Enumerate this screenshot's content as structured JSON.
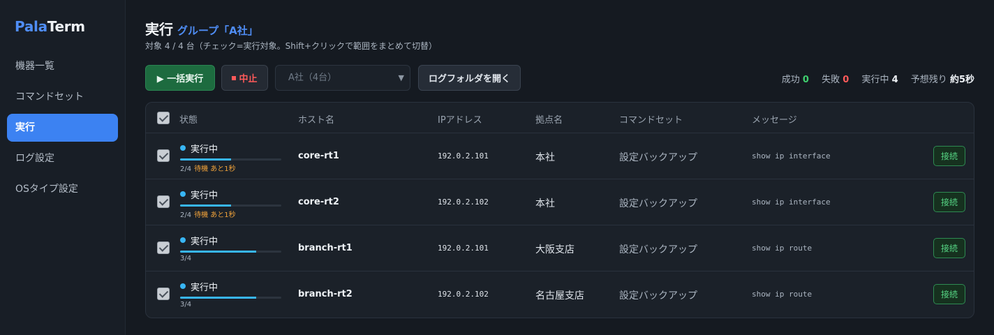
{
  "app": {
    "logo_a": "Pala",
    "logo_b": "Term"
  },
  "sidebar": {
    "items": [
      {
        "label": "機器一覧",
        "active": false
      },
      {
        "label": "コマンドセット",
        "active": false
      },
      {
        "label": "実行",
        "active": true
      },
      {
        "label": "ログ設定",
        "active": false
      },
      {
        "label": "OSタイプ設定",
        "active": false
      }
    ]
  },
  "header": {
    "title": "実行",
    "group": "グループ「A社」",
    "subtitle": "対象 4 / 4 台（チェック=実行対象。Shift+クリックで範囲をまとめて切替）"
  },
  "toolbar": {
    "run_label": "▶ 一括実行",
    "stop_label": "中止",
    "select_value": "A社（4台）",
    "folder_label": "ログフォルダを開く"
  },
  "stats": {
    "success_label": "成功",
    "success_value": "0",
    "fail_label": "失敗",
    "fail_value": "0",
    "running_label": "実行中",
    "running_value": "4",
    "eta_label": "予想残り",
    "eta_value": "約5秒"
  },
  "table": {
    "headers": {
      "status": "状態",
      "host": "ホスト名",
      "ip": "IPアドレス",
      "site": "拠点名",
      "cmdset": "コマンドセット",
      "message": "メッセージ"
    },
    "rows": [
      {
        "status": "実行中",
        "progress_text": "2/4",
        "progress": 0.5,
        "wait_text": "待機 あと1秒",
        "host": "core-rt1",
        "ip": "192.0.2.101",
        "site": "本社",
        "cmdset": "設定バックアップ",
        "message": "show ip interface",
        "connect_label": "接続"
      },
      {
        "status": "実行中",
        "progress_text": "2/4",
        "progress": 0.5,
        "wait_text": "待機 あと1秒",
        "host": "core-rt2",
        "ip": "192.0.2.102",
        "site": "本社",
        "cmdset": "設定バックアップ",
        "message": "show ip interface",
        "connect_label": "接続"
      },
      {
        "status": "実行中",
        "progress_text": "3/4",
        "progress": 0.75,
        "wait_text": "",
        "host": "branch-rt1",
        "ip": "192.0.2.101",
        "site": "大阪支店",
        "cmdset": "設定バックアップ",
        "message": "show ip route",
        "connect_label": "接続"
      },
      {
        "status": "実行中",
        "progress_text": "3/4",
        "progress": 0.75,
        "wait_text": "",
        "host": "branch-rt2",
        "ip": "192.0.2.102",
        "site": "名古屋支店",
        "cmdset": "設定バックアップ",
        "message": "show ip route",
        "connect_label": "接続"
      }
    ]
  },
  "colors": {
    "accent": "#3c82f2",
    "running": "#38b6f4",
    "success": "#3fcf6e",
    "fail": "#ff5a5a",
    "wait": "#f0a23a"
  }
}
